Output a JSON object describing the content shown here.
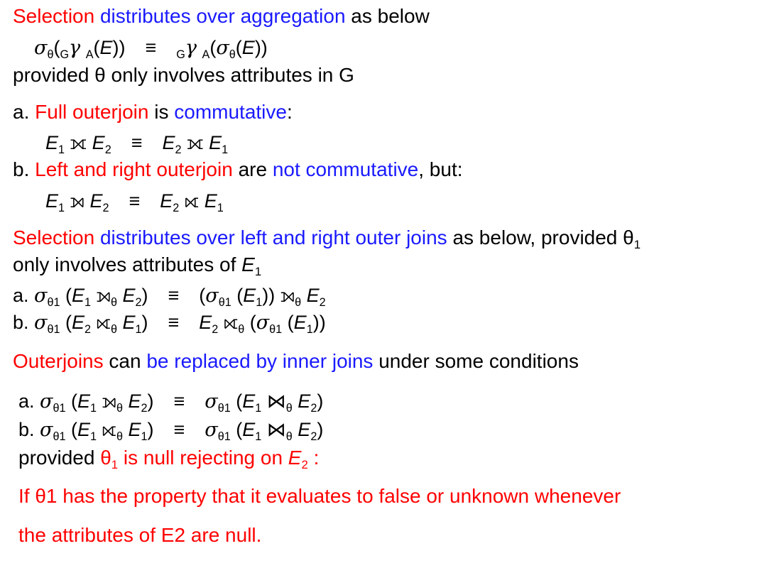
{
  "sel_agg": {
    "red": "Selection",
    "blue": "distributes over aggregation",
    "rest": "as below",
    "provided": "provided θ only involves attributes in G"
  },
  "commute": {
    "a_prefix": "a.",
    "a_red": "Full outerjoin",
    "a_mid": "is",
    "a_blue": "commutative",
    "a_colon": ":",
    "b_prefix": "b.",
    "b_red": "Left and right outerjoin",
    "b_mid": "are",
    "b_blue": "not commutative",
    "b_rest": ", but:"
  },
  "sel_outer": {
    "red": "Selection",
    "blue": "distributes over left and right outer joins",
    "rest": "as below, provided θ",
    "sub": "1",
    "line2": "only involves attributes of",
    "a_prefix": "a.",
    "b_prefix": "b."
  },
  "replace": {
    "red": "Outerjoins",
    "mid": "can",
    "blue": "be replaced by inner joins",
    "rest": "under some conditions",
    "a_prefix": "a.",
    "b_prefix": "b.",
    "provided": "provided",
    "null_rejecting": "is null rejecting on",
    "colon": ":"
  },
  "note": {
    "line1": "If θ1 has the property that it evaluates to false or unknown whenever",
    "line2": "the attributes of E2 are null."
  }
}
